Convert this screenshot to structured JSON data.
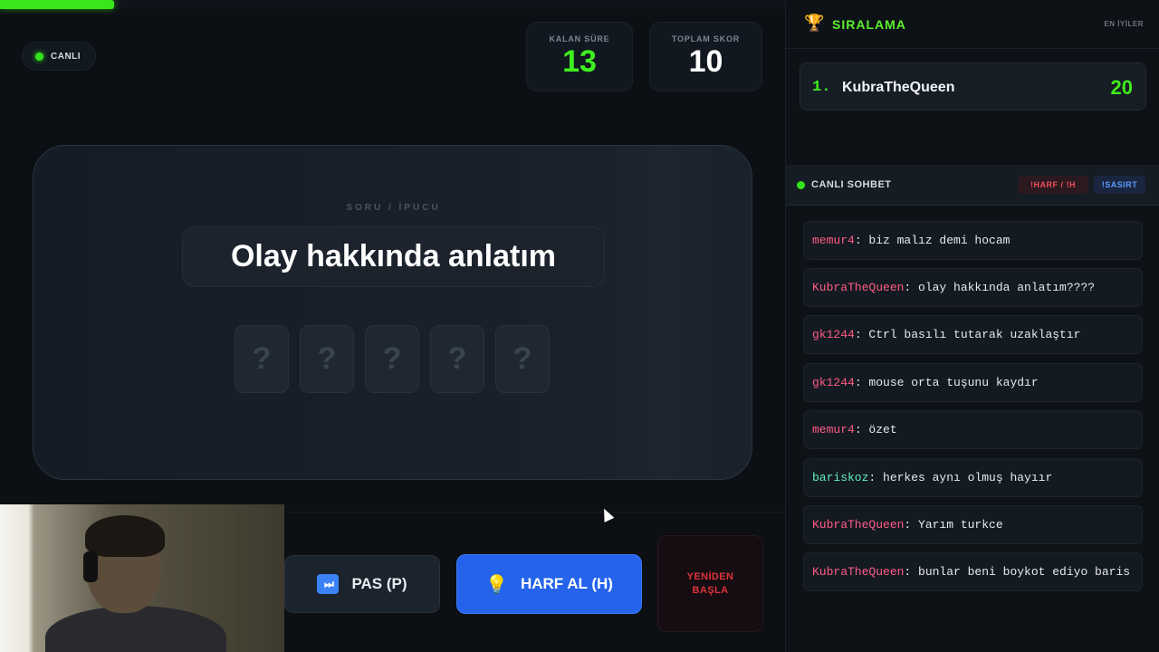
{
  "progress": {
    "fraction": 0.145
  },
  "status": {
    "live_label": "CANLI"
  },
  "stats": {
    "time_label": "KALAN SÜRE",
    "time_value": "13",
    "score_label": "TOPLAM SKOR",
    "score_value": "10"
  },
  "question": {
    "label": "SORU / İPUCU",
    "clue": "Olay hakkında anlatım",
    "tiles": [
      "?",
      "?",
      "?",
      "?",
      "?"
    ]
  },
  "actions": {
    "pass_label": "PAS (P)",
    "pass_icon": "⏭",
    "hint_label": "HARF AL (H)",
    "hint_icon": "💡",
    "restart_line1": "YENİDEN",
    "restart_line2": "BAŞLA"
  },
  "leaderboard": {
    "title": "SIRALAMA",
    "subtitle": "EN İYİLER",
    "entries": [
      {
        "rank": "1.",
        "name": "KubraTheQueen",
        "score": "20"
      }
    ]
  },
  "chat": {
    "title": "CANLI SOHBET",
    "cmd_harf": "!HARF / !H",
    "cmd_sasirt": "!SASIRT",
    "messages": [
      {
        "user": "memur4",
        "text": ": biz malız demi hocam",
        "color": "#ff5c86"
      },
      {
        "user": "KubraTheQueen",
        "text": ": olay hakkında anlatım????",
        "color": "#ff5c86"
      },
      {
        "user": "gk1244",
        "text": ": Ctrl basılı tutarak uzaklaştır",
        "color": "#ff5c86"
      },
      {
        "user": "gk1244",
        "text": ": mouse orta tuşunu kaydır",
        "color": "#ff5c86"
      },
      {
        "user": "memur4",
        "text": ": özet",
        "color": "#ff5c86"
      },
      {
        "user": "bariskoz",
        "text": ": herkes aynı olmuş hayıır",
        "color": "#63f0bc"
      },
      {
        "user": "KubraTheQueen",
        "text": ": Yarım turkce",
        "color": "#ff5c86"
      },
      {
        "user": "KubraTheQueen",
        "text": ": bunlar beni boykot ediyo baris",
        "color": "#ff5c86"
      }
    ]
  }
}
